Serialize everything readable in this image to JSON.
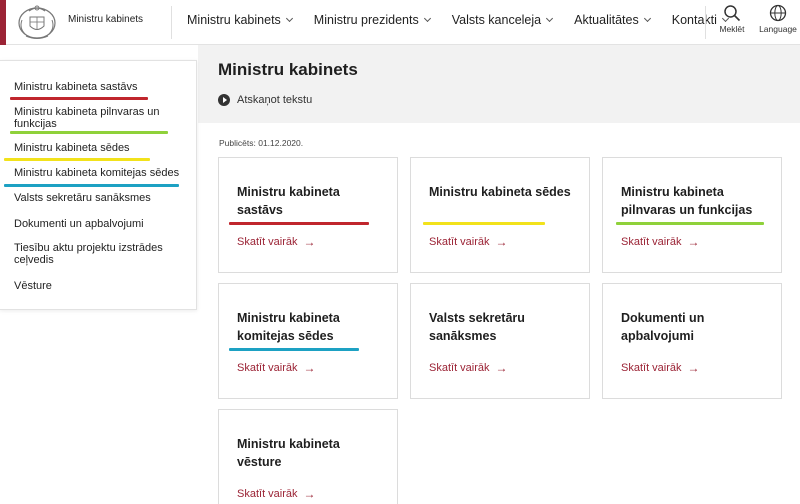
{
  "header": {
    "site_name": "Ministru kabinets",
    "nav": [
      {
        "label": "Ministru kabinets"
      },
      {
        "label": "Ministru prezidents"
      },
      {
        "label": "Valsts kanceleja"
      },
      {
        "label": "Aktualitātes"
      },
      {
        "label": "Kontakti"
      }
    ],
    "search_label": "Meklēt",
    "language_label": "Language",
    "icons": {
      "search": "search-icon",
      "language": "globe-icon",
      "logo": "coat-of-arms-logo"
    }
  },
  "sidebar": {
    "items": [
      {
        "label": "Ministru kabineta sastāvs",
        "underline": "#c0262d"
      },
      {
        "label": "Ministru kabineta pilnvaras un funkcijas",
        "underline": "#8fd13a"
      },
      {
        "label": "Ministru kabineta sēdes",
        "underline": "#f2e21b"
      },
      {
        "label": "Ministru kabineta komitejas sēdes",
        "underline": "#1da1c3"
      },
      {
        "label": "Valsts sekretāru sanāksmes"
      },
      {
        "label": "Dokumenti un apbalvojumi"
      },
      {
        "label": "Tiesību aktu projektu izstrādes ceļvedis"
      },
      {
        "label": "Vēsture"
      }
    ]
  },
  "main": {
    "title": "Ministru kabinets",
    "listen_label": "Atskaņot tekstu",
    "published": "Publicēts: 01.12.2020."
  },
  "cards": [
    {
      "title": "Ministru kabineta sastāvs",
      "link": "Skatīt vairāk",
      "underline": "#c0262d"
    },
    {
      "title": "Ministru kabineta sēdes",
      "link": "Skatīt vairāk",
      "underline": "#f2e21b"
    },
    {
      "title": "Ministru kabineta pilnvaras un funkcijas",
      "link": "Skatīt vairāk",
      "underline": "#8fd13a"
    },
    {
      "title": "Ministru kabineta komitejas sēdes",
      "link": "Skatīt vairāk",
      "underline": "#1da1c3"
    },
    {
      "title": "Valsts sekretāru sanāksmes",
      "link": "Skatīt vairāk"
    },
    {
      "title": "Dokumenti un apbalvojumi",
      "link": "Skatīt vairāk"
    },
    {
      "title": "Ministru kabineta vēsture",
      "link": "Skatīt vairāk"
    }
  ],
  "colors": {
    "brand": "#9b2335",
    "link": "#9b2335",
    "hero_bg": "#f2f2f2"
  }
}
